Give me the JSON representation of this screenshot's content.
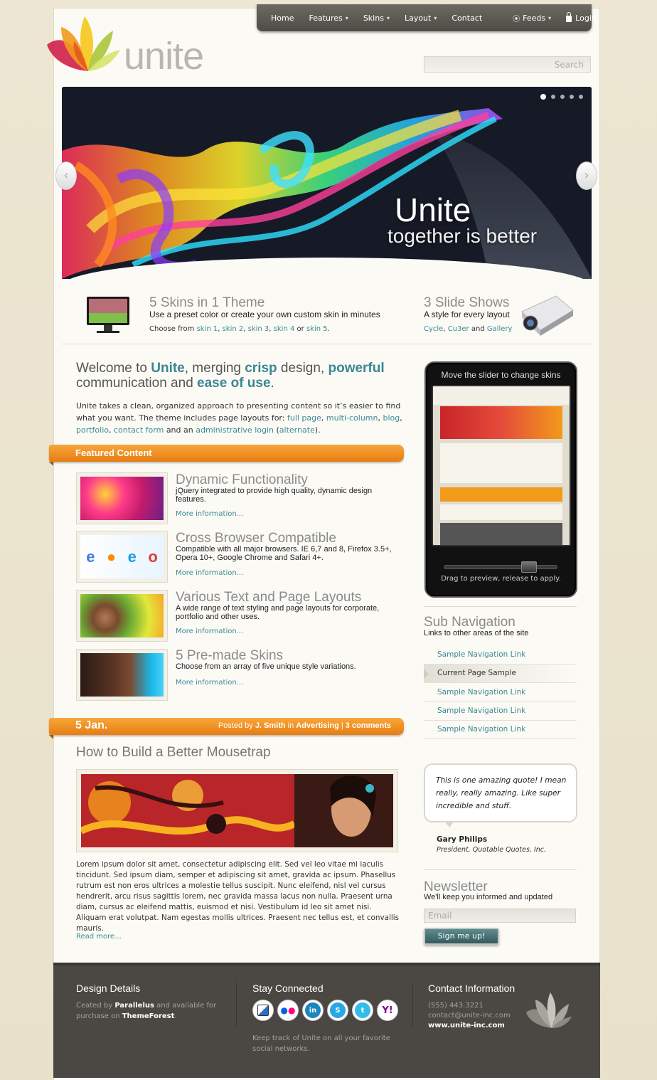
{
  "nav": {
    "items": [
      {
        "label": "Home",
        "caret": false
      },
      {
        "label": "Features",
        "caret": true
      },
      {
        "label": "Skins",
        "caret": true
      },
      {
        "label": "Layout",
        "caret": true
      },
      {
        "label": "Contact",
        "caret": false
      }
    ],
    "feeds": "Feeds",
    "login": "Login"
  },
  "logo": {
    "text": "unite"
  },
  "search": {
    "placeholder": "Search"
  },
  "hero": {
    "title": "Unite",
    "subtitle": "together is better",
    "slide_count": 5,
    "active_slide": 1
  },
  "features": {
    "skins": {
      "title": "5 Skins in 1 Theme",
      "desc": "Use a preset color or create your own custom skin in minutes",
      "choose_prefix": "Choose from",
      "links": [
        "skin 1",
        "skin 2",
        "skin 3",
        "skin 4",
        "skin 5"
      ],
      "or": "or"
    },
    "slides": {
      "title": "3 Slide Shows",
      "desc": "A style for every layout",
      "links": [
        "Cycle",
        "Cu3er",
        "Gallery"
      ],
      "and": "and"
    }
  },
  "welcome": {
    "w1": "Welcome to ",
    "h1": "Unite",
    "w2": ", merging ",
    "h2": "crisp",
    "w3": " design, ",
    "h3": "powerful",
    "w4": "communication and ",
    "h4": "ease of use",
    "w5": ".",
    "p1": "Unite takes a clean, organized approach to presenting content so it’s easier to find what you want. The theme includes page layouts for:",
    "links": [
      "full page",
      "multi-column",
      "blog",
      "portfolio",
      "contact form"
    ],
    "and_an": "and an",
    "admin": "administrative login",
    "alt": "alternate",
    "tail": ")."
  },
  "featured": {
    "header": "Featured Content",
    "items": [
      {
        "title": "Dynamic Functionality",
        "desc": "jQuery integrated to provide high quality, dynamic design features.",
        "more": "More information..."
      },
      {
        "title": "Cross Browser Compatible",
        "desc": "Compatible with all major browsers. IE 6,7 and 8, Firefox 3.5+, Opera 10+, Google Chrome and Safari 4+.",
        "more": "More information..."
      },
      {
        "title": "Various Text and Page Layouts",
        "desc": "A wide range of text styling and page layouts for corporate, portfolio and other uses.",
        "more": "More information..."
      },
      {
        "title": "5 Pre-made Skins",
        "desc": "Choose from an array of five unique style variations.",
        "more": "More information..."
      }
    ]
  },
  "post": {
    "date": "5 Jan.",
    "posted_by": "Posted by",
    "author": "J. Smith",
    "in": "in",
    "category": "Advertising",
    "comments": "3 comments",
    "title": "How to Build a Better Mousetrap",
    "body": "Lorem ipsum dolor sit amet, consectetur adipiscing elit. Sed vel leo vitae mi iaculis tincidunt. Sed ipsum diam, semper et adipiscing sit amet, gravida ac ipsum. Phasellus rutrum est non eros ultrices a molestie tellus suscipit. Nunc eleifend, nisl vel cursus hendrerit, arcu risus sagittis lorem, nec gravida massa lacus non nulla. Praesent urna diam, cursus ac eleifend mattis, euismod et nisi. Vestibulum id leo sit amet nisi. Aliquam erat volutpat. Nam egestas mollis ultrices. Praesent nec tellus est, et convallis mauris.",
    "read_more": "Read more..."
  },
  "phone": {
    "top": "Move the slider to change skins",
    "bottom": "Drag to preview, release to apply."
  },
  "subnav": {
    "title": "Sub Navigation",
    "desc": "Links to other areas of the site",
    "items": [
      {
        "label": "Sample Navigation Link",
        "current": false
      },
      {
        "label": "Current Page Sample",
        "current": true
      },
      {
        "label": "Sample Navigation Link",
        "current": false
      },
      {
        "label": "Sample Navigation Link",
        "current": false
      },
      {
        "label": "Sample Navigation Link",
        "current": false
      }
    ]
  },
  "quote": {
    "text": "This is one amazing quote! I mean really, really amazing. Like super incredible and stuff.",
    "name": "Gary Philips",
    "role": "President, Quotable Quotes, Inc."
  },
  "newsletter": {
    "title": "Newsletter",
    "desc": "We'll keep you informed and updated",
    "placeholder": "Email",
    "button": "Sign me up!"
  },
  "footer": {
    "design": {
      "title": "Design Details",
      "created_by": "Ceated by",
      "author": "Parallelus",
      "available": "and available for purchase on",
      "market": "ThemeForest",
      "dot": "."
    },
    "connected": {
      "title": "Stay Connected",
      "social": [
        {
          "icon": "delicious-icon",
          "glyph": "",
          "color": "#2a6dc4"
        },
        {
          "icon": "flickr-icon",
          "glyph": "●●",
          "color": "#ffffff"
        },
        {
          "icon": "linkedin-icon",
          "glyph": "in",
          "color": "#1b86bc"
        },
        {
          "icon": "skype-icon",
          "glyph": "S",
          "color": "#27a7e3"
        },
        {
          "icon": "twitter-icon",
          "glyph": "t",
          "color": "#33bbe9"
        },
        {
          "icon": "yahoo-icon",
          "glyph": "Y!",
          "color": "#7b0099"
        }
      ],
      "text": "Keep track of Unite on all your favorite social networks."
    },
    "contact": {
      "title": "Contact Information",
      "phone": "(555) 443.3221",
      "email": "contact@unite-inc.com",
      "web": "www.unite-inc.com"
    }
  }
}
